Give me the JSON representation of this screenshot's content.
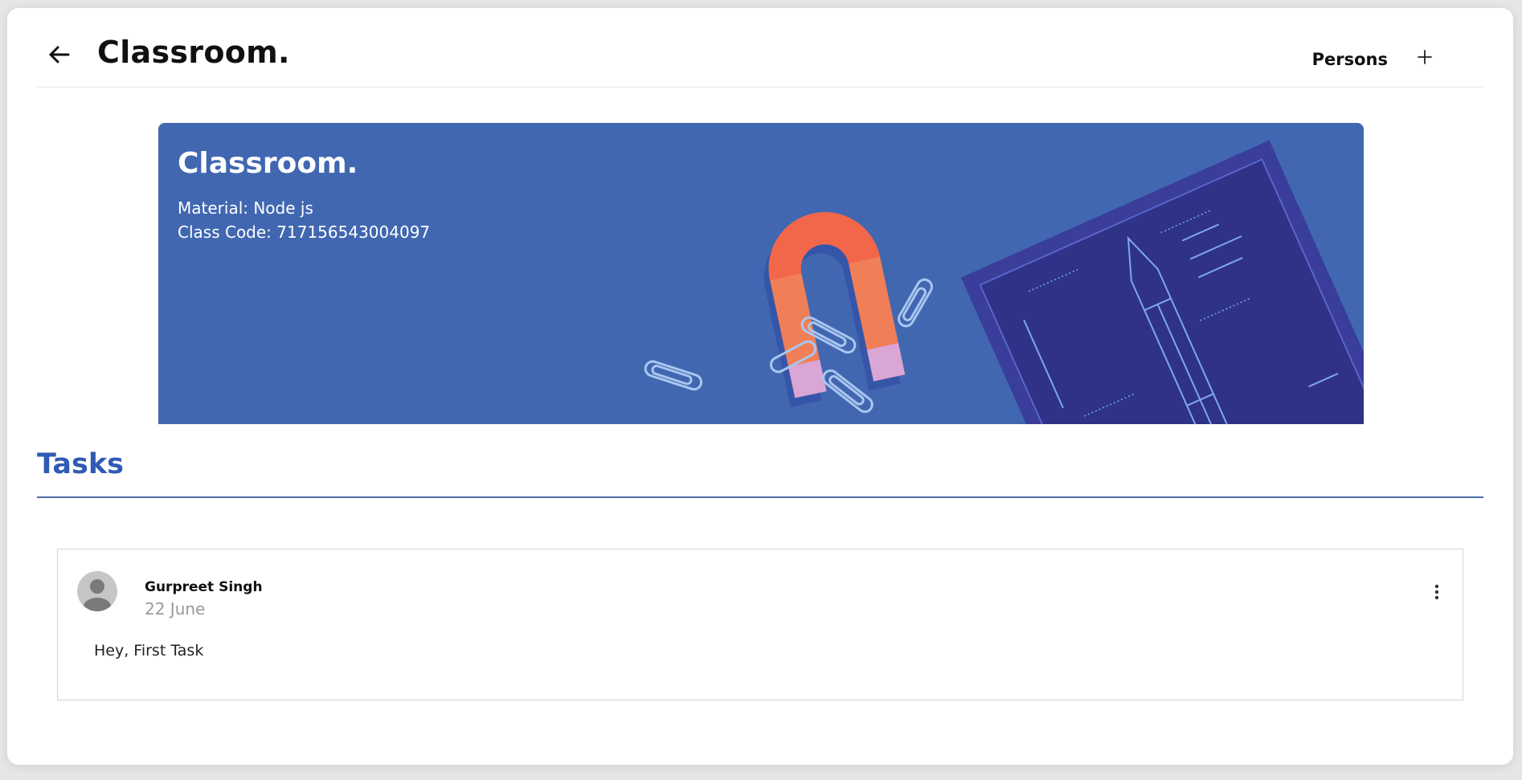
{
  "header": {
    "title": "Classroom.",
    "persons_label": "Persons",
    "back_icon": "arrow-left-icon",
    "add_icon": "plus-icon"
  },
  "banner": {
    "title": "Classroom.",
    "material": "Material: Node js",
    "class_code": "Class Code: 717156543004097",
    "background_color": "#4167b1"
  },
  "tasks": {
    "heading": "Tasks",
    "items": [
      {
        "author": "Gurpreet Singh",
        "date": "22 June",
        "text": "Hey, First Task",
        "avatar_icon": "person-icon",
        "menu_icon": "more-vertical-icon"
      }
    ]
  },
  "colors": {
    "accent": "#2f5bb5",
    "rule": "#4b6aa6"
  }
}
